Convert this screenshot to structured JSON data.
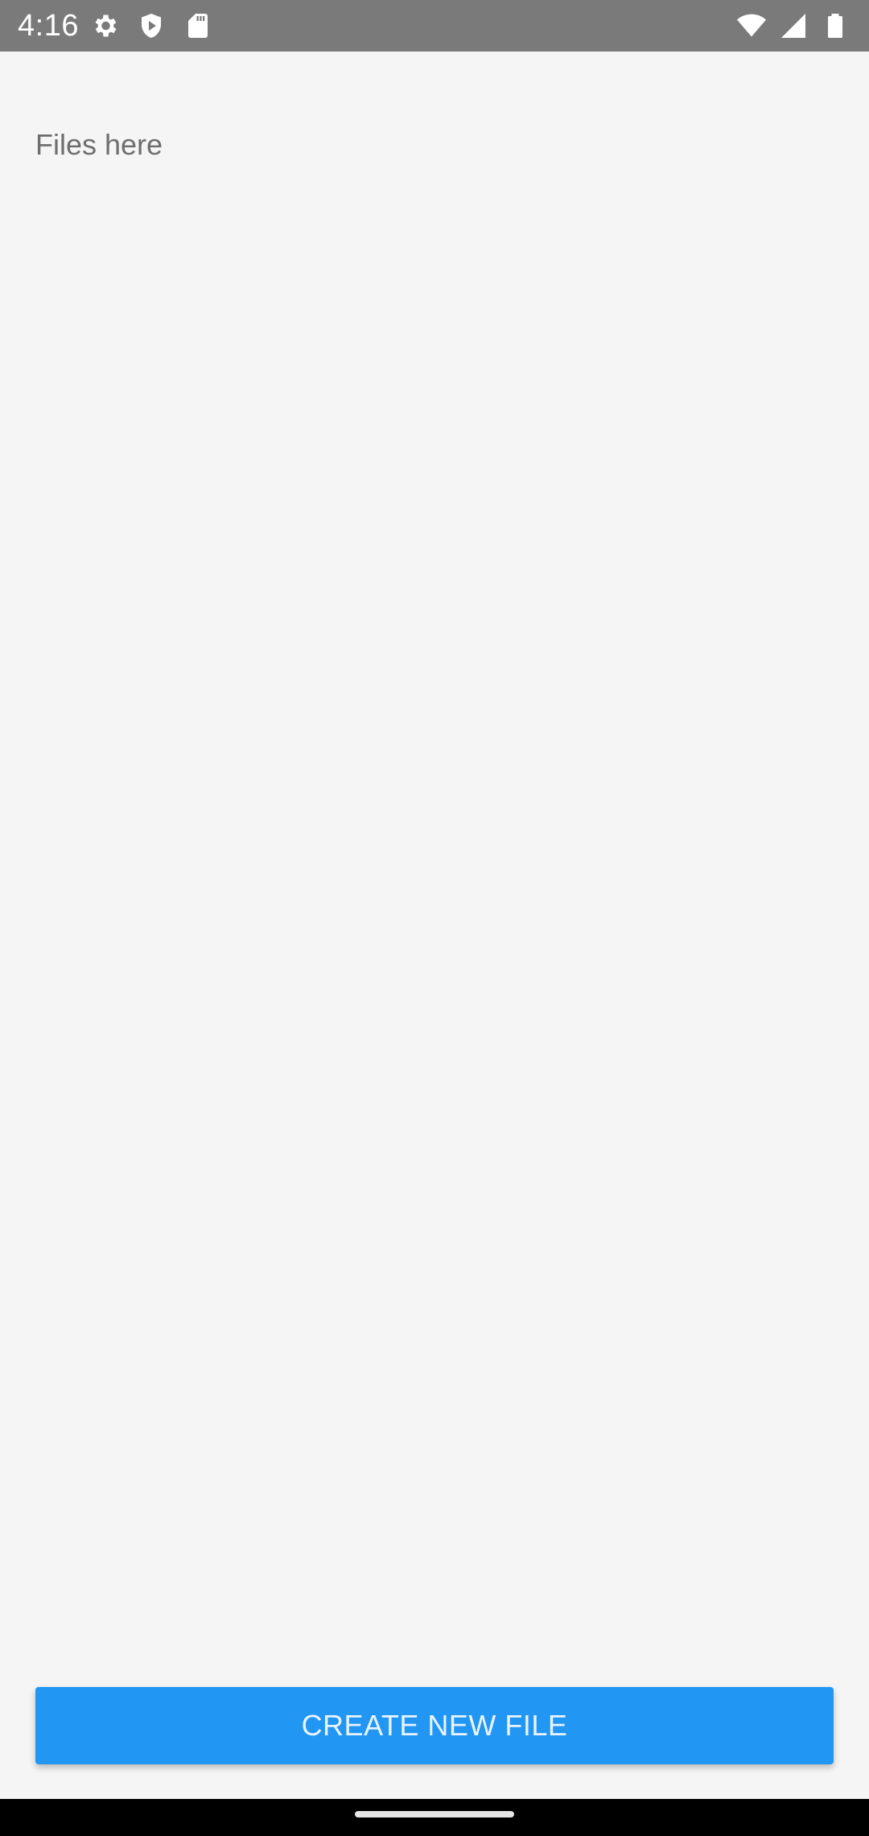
{
  "status_bar": {
    "time": "4:16",
    "left_icons": [
      "settings-icon",
      "shield-play-icon",
      "sd-card-icon"
    ],
    "right_icons": [
      "wifi-icon",
      "cell-signal-icon",
      "battery-icon"
    ]
  },
  "main": {
    "empty_text": "Files here",
    "create_button_label": "CREATE NEW FILE"
  },
  "colors": {
    "background": "#f5f5f5",
    "status_bar": "#7a7a7a",
    "accent": "#2196f3",
    "nav_bar": "#000000"
  }
}
